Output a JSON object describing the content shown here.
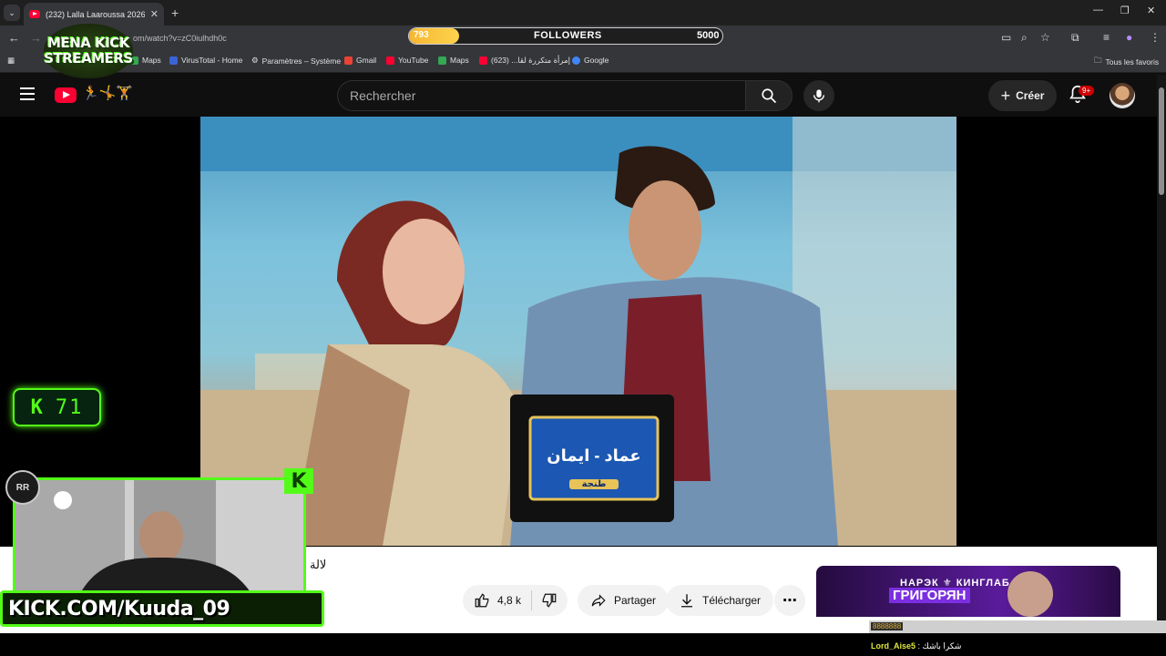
{
  "browser": {
    "tab_title": "(232) Lalla Laaroussa 2026 Prim",
    "url": "om/watch?v=zC0iulhdh0c",
    "bookmarks": [
      {
        "label": "Maps",
        "color": "#34a853"
      },
      {
        "label": "VirusTotal - Home",
        "color": "#3a63d6"
      },
      {
        "label": "Paramètres – Système",
        "color": "#cfcfcf"
      },
      {
        "label": "Gmail",
        "color": "#ea4335"
      },
      {
        "label": "YouTube",
        "color": "#ff0033"
      },
      {
        "label": "Maps",
        "color": "#34a853"
      },
      {
        "label": "إمرأة متكررة لقا... (623)",
        "color": "#ff0033"
      },
      {
        "label": "Google",
        "color": "#4285f4"
      }
    ],
    "all_favorites": "Tous les favoris"
  },
  "overlay": {
    "followers_current": "793",
    "followers_label": "FOLLOWERS",
    "followers_goal": "5000",
    "followers_progress": 0.16,
    "logo_line1": "MENA KICK",
    "logo_line2": "STREAMERS",
    "kick_counter": "71",
    "kick_url": "KICK.COM/Kuuda_09",
    "badge_text": "RR",
    "cam_k": "K",
    "chat_user": "Lord_Aise5",
    "chat_message": "شكرا باشك",
    "ticker_name": "8888888"
  },
  "youtube": {
    "search_placeholder": "Rechercher",
    "create_label": "Créer",
    "notif_count": "9+",
    "doodle": "🏃🤸🏋",
    "video_caption_name": "عماد - ايمان",
    "video_caption_city": "طنجة",
    "title_fragment": "لالة",
    "like_count": "4,8 k",
    "share_label": "Partager",
    "download_label": "Télécharger",
    "ad_line1": "НАРЭК ⚜ КИНГЛАБ",
    "ad_line2": "ГРИГОРЯН"
  }
}
